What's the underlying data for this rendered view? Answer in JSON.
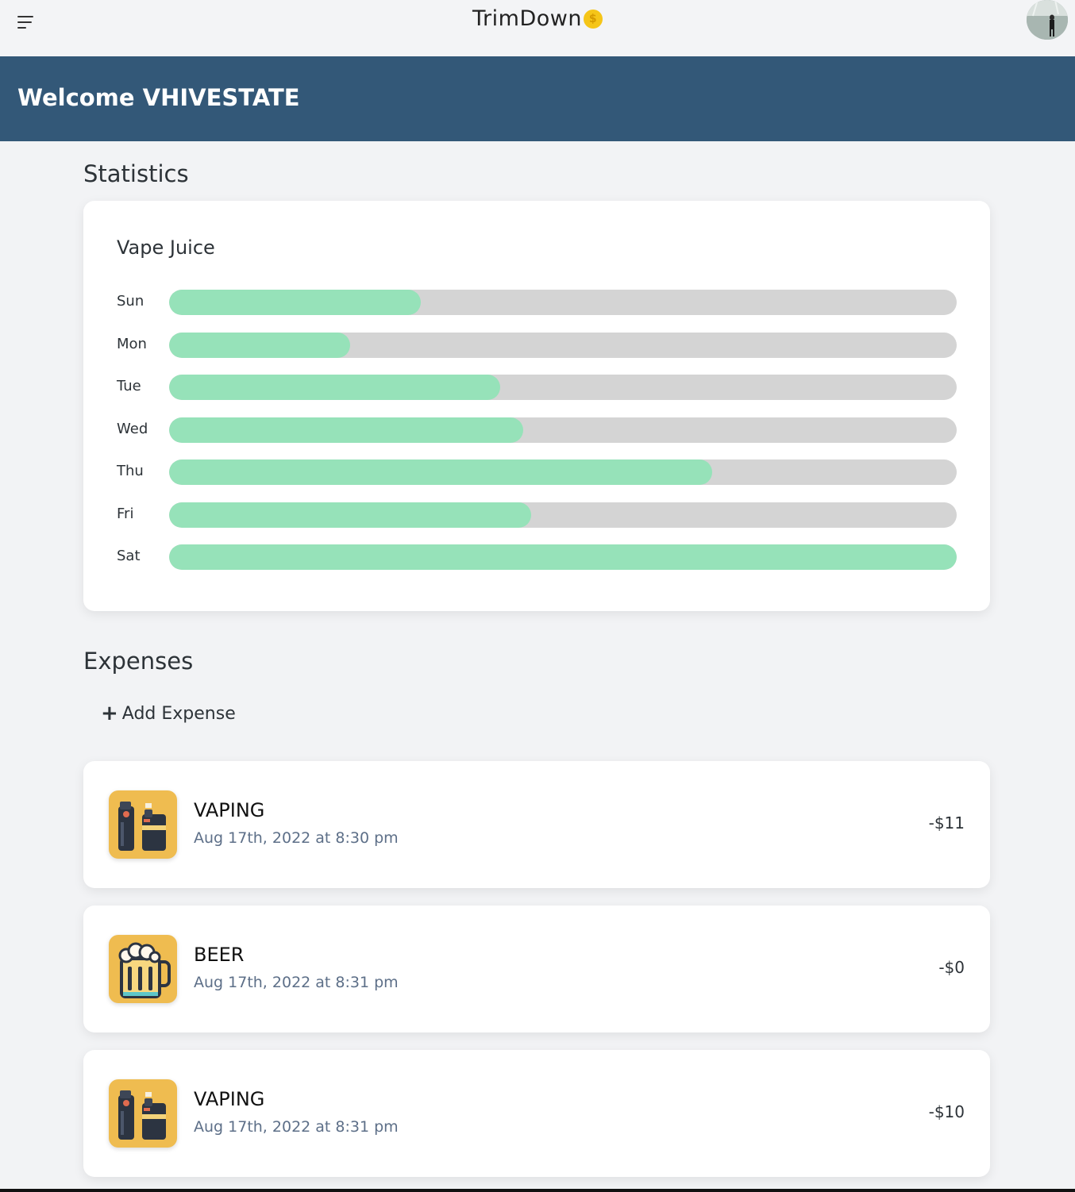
{
  "header": {
    "app_name": "TrimDown",
    "coin_symbol": "$"
  },
  "banner": {
    "welcome": "Welcome VHIVESTATE"
  },
  "statistics": {
    "section_title": "Statistics"
  },
  "chart_data": {
    "type": "bar",
    "orientation": "horizontal",
    "title": "Vape Juice",
    "categories": [
      "Sun",
      "Mon",
      "Tue",
      "Wed",
      "Thu",
      "Fri",
      "Sat"
    ],
    "values": [
      0.32,
      0.23,
      0.42,
      0.45,
      0.69,
      0.46,
      1.0
    ],
    "value_scale": "fraction of maximum",
    "colors": {
      "fill": "#96e2b9",
      "track": "#d4d4d4"
    }
  },
  "expenses": {
    "section_title": "Expenses",
    "add_label": "Add Expense",
    "add_icon": "+",
    "items": [
      {
        "title": "VAPING",
        "date": "Aug 17th, 2022 at 8:30 pm",
        "amount": "-$11",
        "icon": "vape-icon"
      },
      {
        "title": "BEER",
        "date": "Aug 17th, 2022 at 8:31 pm",
        "amount": "-$0",
        "icon": "beer-icon"
      },
      {
        "title": "VAPING",
        "date": "Aug 17th, 2022 at 8:31 pm",
        "amount": "-$10",
        "icon": "vape-icon"
      }
    ]
  },
  "colors": {
    "banner": "#335878",
    "icon_background": "#efbc50",
    "date_text": "#5d6f88"
  }
}
